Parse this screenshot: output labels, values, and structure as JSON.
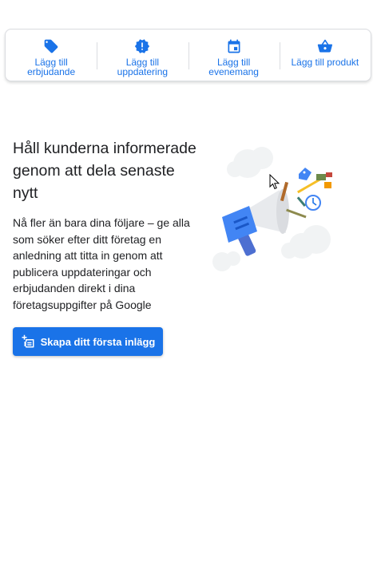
{
  "actions": [
    {
      "icon": "tag-icon",
      "label": "Lägg till\nerbjudande"
    },
    {
      "icon": "update-badge-icon",
      "label": "Lägg till\nuppdatering"
    },
    {
      "icon": "calendar-icon",
      "label": "Lägg till\nevenemang"
    },
    {
      "icon": "shopping-basket-icon",
      "label": "Lägg till produkt"
    }
  ],
  "main": {
    "headline": "Håll kunderna informerade genom att dela senaste nytt",
    "body": "Nå fler än bara dina följare – ge alla som söker efter ditt företag en anledning att titta in genom att publicera uppdateringar och erbjudanden direkt i dina företagsuppgifter på Google",
    "cta_label": "Skapa ditt första inlägg",
    "cta_icon": "add-post-icon",
    "illustration": "megaphone-illustration"
  },
  "colors": {
    "accent": "#1a73e8",
    "text": "#202124",
    "border": "#dadce0"
  }
}
